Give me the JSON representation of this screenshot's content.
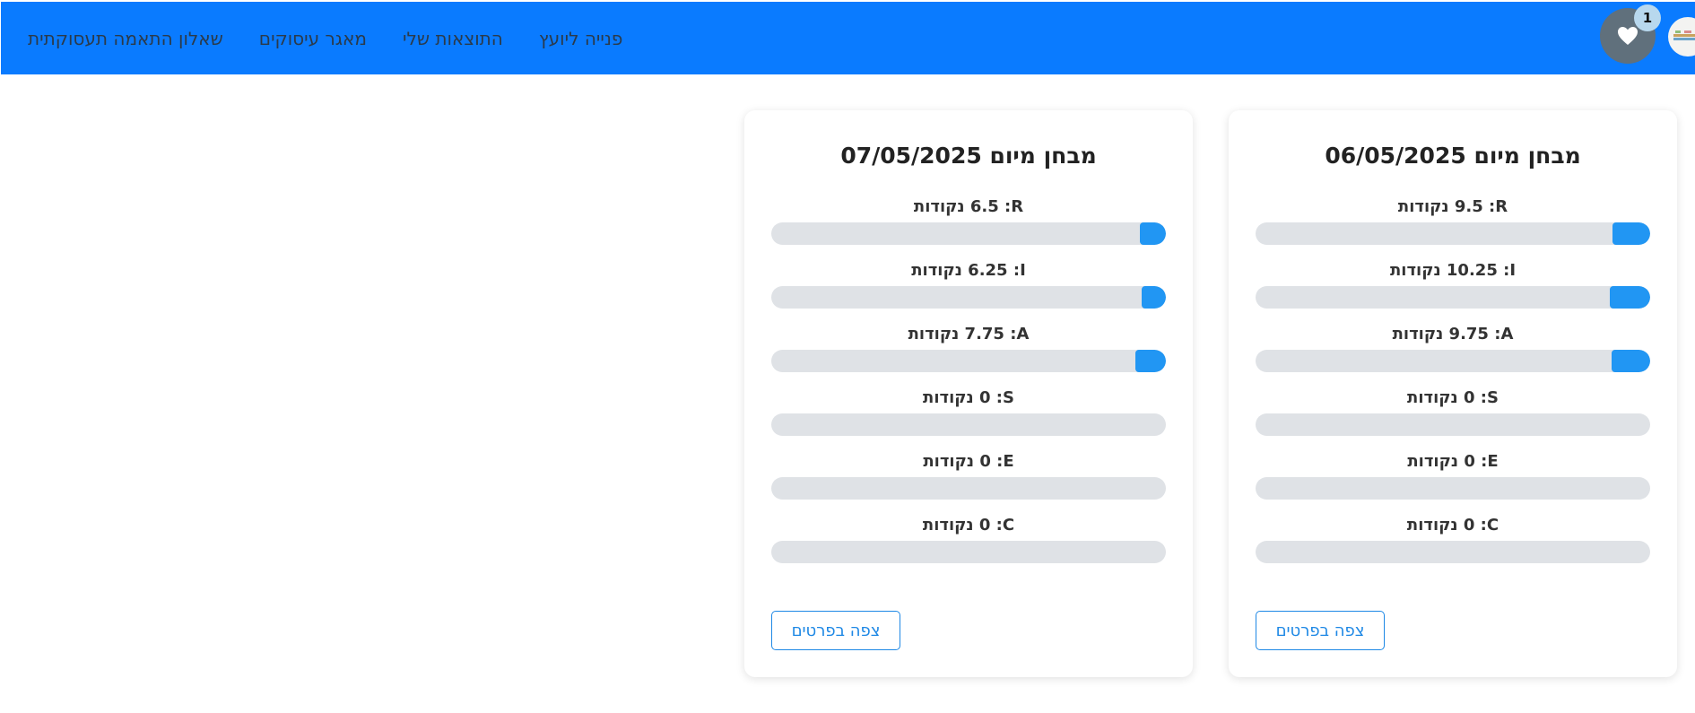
{
  "nav": {
    "links": [
      {
        "label": "שאלון התאמה תעסוקתית"
      },
      {
        "label": "מאגר עיסוקים"
      },
      {
        "label": "התוצאות שלי"
      },
      {
        "label": "פנייה ליועץ"
      }
    ],
    "favorites_count": "1",
    "favorites_icon": "heart-icon",
    "colors": {
      "navbar": "#0a7bff",
      "accent": "#2196f3"
    }
  },
  "points_word": "נקודות",
  "results": [
    {
      "title": "מבחן מיום 06/05/2025",
      "button_label": "צפה בפרטים",
      "scores": [
        {
          "code": "R",
          "value": "9.5",
          "fill_pct": 9.5
        },
        {
          "code": "I",
          "value": "10.25",
          "fill_pct": 10.25
        },
        {
          "code": "A",
          "value": "9.75",
          "fill_pct": 9.75
        },
        {
          "code": "S",
          "value": "0",
          "fill_pct": 0
        },
        {
          "code": "E",
          "value": "0",
          "fill_pct": 0
        },
        {
          "code": "C",
          "value": "0",
          "fill_pct": 0
        }
      ]
    },
    {
      "title": "מבחן מיום 07/05/2025",
      "button_label": "צפה בפרטים",
      "scores": [
        {
          "code": "R",
          "value": "6.5",
          "fill_pct": 6.5
        },
        {
          "code": "I",
          "value": "6.25",
          "fill_pct": 6.25
        },
        {
          "code": "A",
          "value": "7.75",
          "fill_pct": 7.75
        },
        {
          "code": "S",
          "value": "0",
          "fill_pct": 0
        },
        {
          "code": "E",
          "value": "0",
          "fill_pct": 0
        },
        {
          "code": "C",
          "value": "0",
          "fill_pct": 0
        }
      ]
    }
  ]
}
